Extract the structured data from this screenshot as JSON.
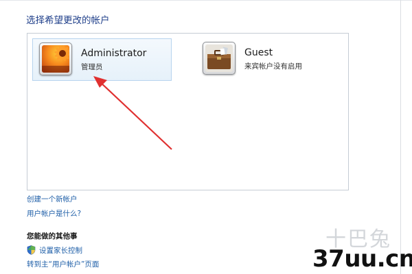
{
  "page": {
    "heading": "选择希望更改的帐户"
  },
  "accounts": [
    {
      "name": "Administrator",
      "type": "管理员",
      "picture_icon": "orange-flower-picture"
    },
    {
      "name": "Guest",
      "type": "来宾帐户没有启用",
      "picture_icon": "briefcase-picture"
    }
  ],
  "links": {
    "create_account": "创建一个新帐户",
    "what_is_account": "用户帐户是什么?"
  },
  "other_tasks": {
    "title": "您能做的其他事",
    "parental_controls": "设置家长控制",
    "goto_main": "转到主“用户帐户”页面"
  },
  "watermark": {
    "logo_text": "37uu.cn",
    "glyphs": "十巴兔"
  },
  "colors": {
    "heading": "#1f3f8a",
    "link": "#1f5fa8",
    "selection_border": "#b6d3ee",
    "annotation_arrow": "#e03030"
  }
}
